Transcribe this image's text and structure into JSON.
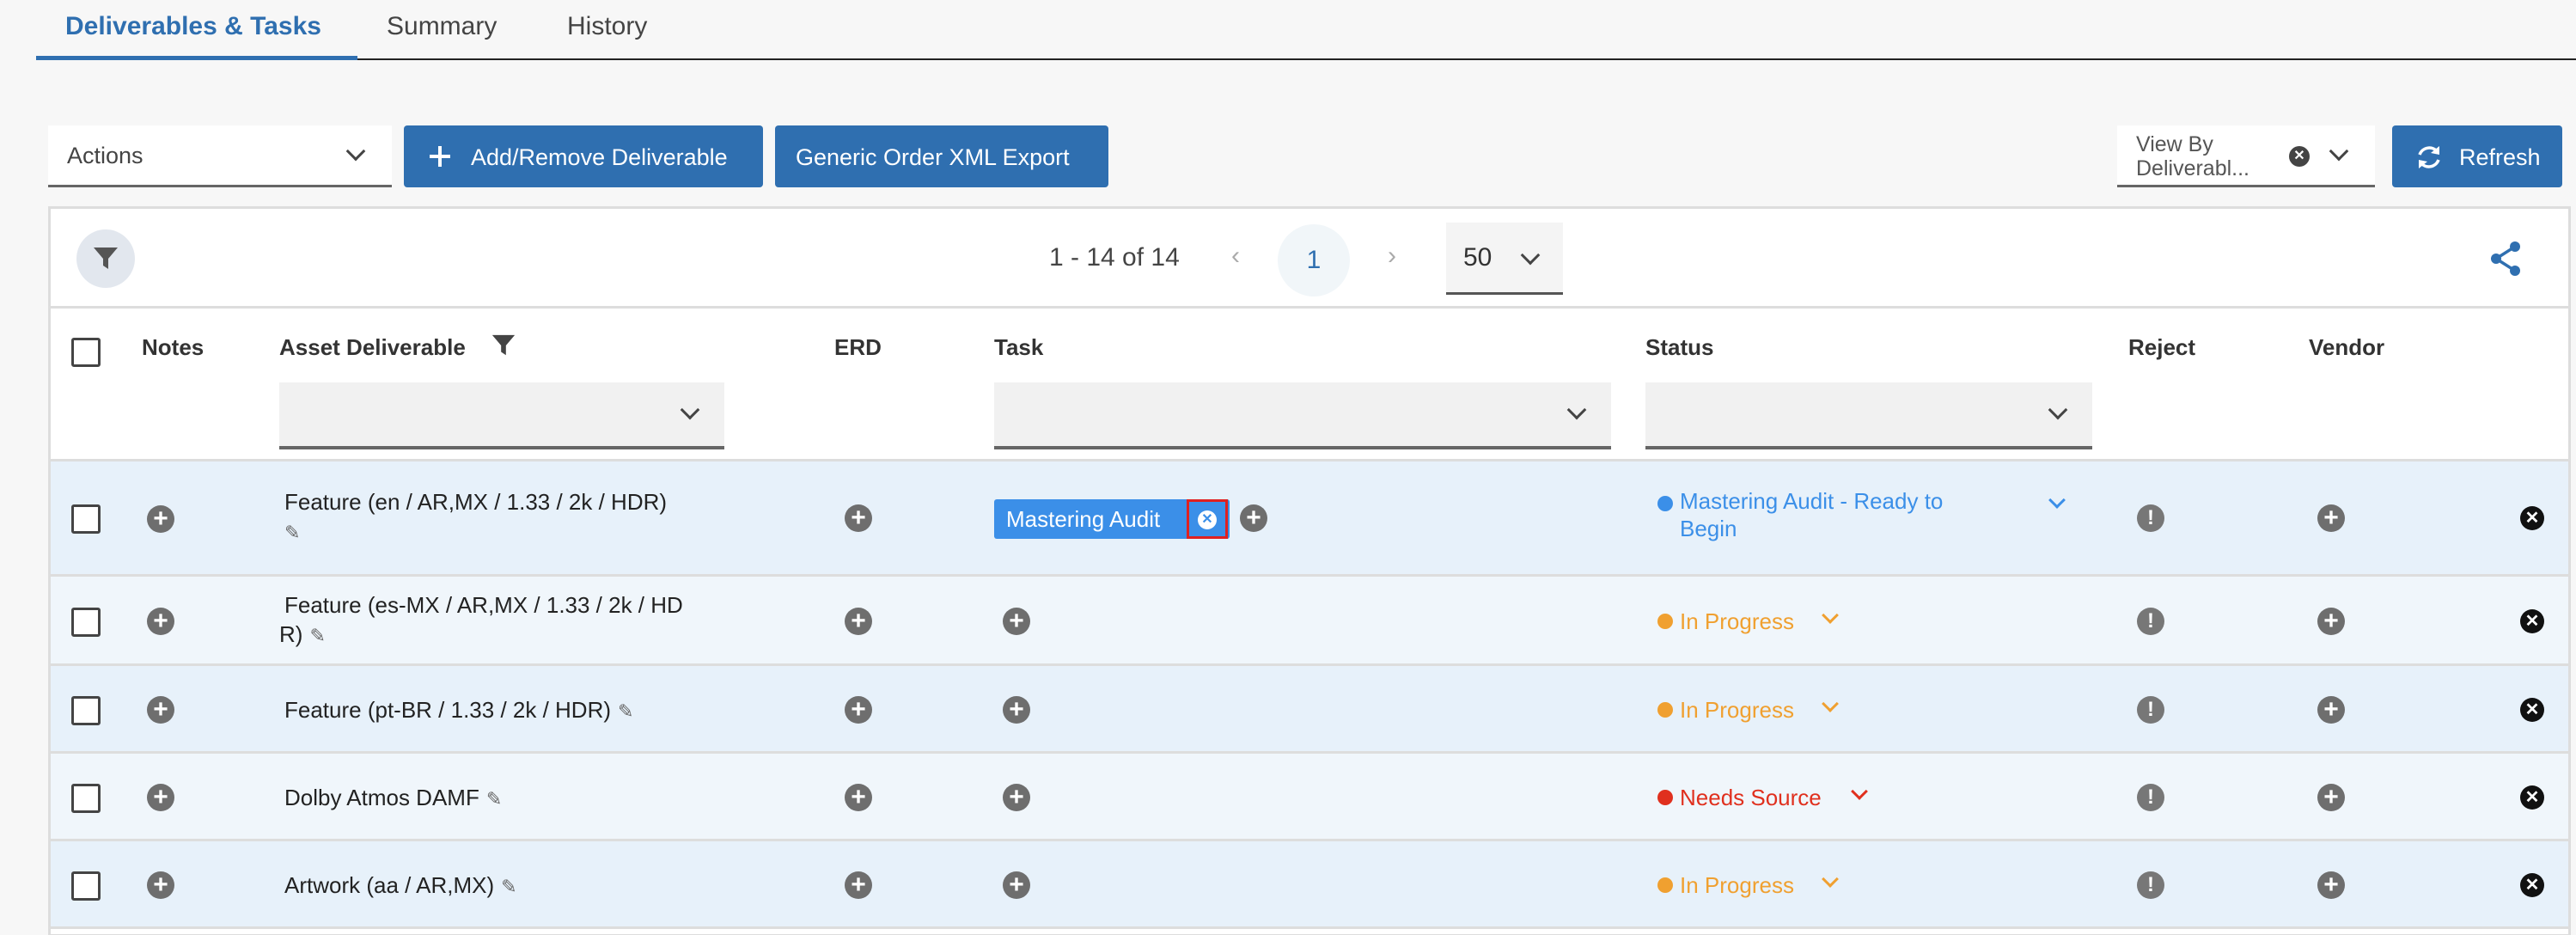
{
  "tabs": [
    {
      "label": "Deliverables & Tasks",
      "active": true
    },
    {
      "label": "Summary",
      "active": false
    },
    {
      "label": "History",
      "active": false
    }
  ],
  "toolbar": {
    "actions_label": "Actions",
    "add_remove_label": "Add/Remove Deliverable",
    "xml_export_label": "Generic Order XML Export",
    "view_by_line1": "View By",
    "view_by_line2": "Deliverabl...",
    "refresh_label": "Refresh"
  },
  "pager": {
    "range_text": "1 - 14 of 14",
    "prev_glyph": "‹",
    "next_glyph": "›",
    "current_page": "1",
    "page_size": "50"
  },
  "columns": {
    "notes": "Notes",
    "asset": "Asset Deliverable",
    "erd": "ERD",
    "task": "Task",
    "status": "Status",
    "reject": "Reject",
    "vendor": "Vendor"
  },
  "rows": [
    {
      "asset_line1": "Feature (en / AR,MX / 1.33 / 2k / HDR)",
      "asset_line2": "",
      "task_chip": "Mastering Audit",
      "status_line1": "Mastering Audit - Ready to",
      "status_line2": "Begin",
      "status_color": "#3b8fe8"
    },
    {
      "asset_line1": "Feature (es-MX / AR,MX / 1.33 / 2k / HD",
      "asset_line2": "R)",
      "task_chip": "",
      "status_line1": "In Progress",
      "status_line2": "",
      "status_color": "#f0a030"
    },
    {
      "asset_line1": "Feature (pt-BR / 1.33 / 2k / HDR)",
      "asset_line2": "",
      "task_chip": "",
      "status_line1": "In Progress",
      "status_line2": "",
      "status_color": "#f0a030"
    },
    {
      "asset_line1": "Dolby Atmos DAMF",
      "asset_line2": "",
      "task_chip": "",
      "status_line1": "Needs Source",
      "status_line2": "",
      "status_color": "#e0301e"
    },
    {
      "asset_line1": "Artwork (aa / AR,MX)",
      "asset_line2": "",
      "task_chip": "",
      "status_line1": "In Progress",
      "status_line2": "",
      "status_color": "#f0a030"
    }
  ],
  "colors": {
    "accent": "#2f6fb0",
    "chip_blue": "#3b8fe8",
    "in_progress": "#f0a030",
    "needs_source": "#e0301e"
  }
}
